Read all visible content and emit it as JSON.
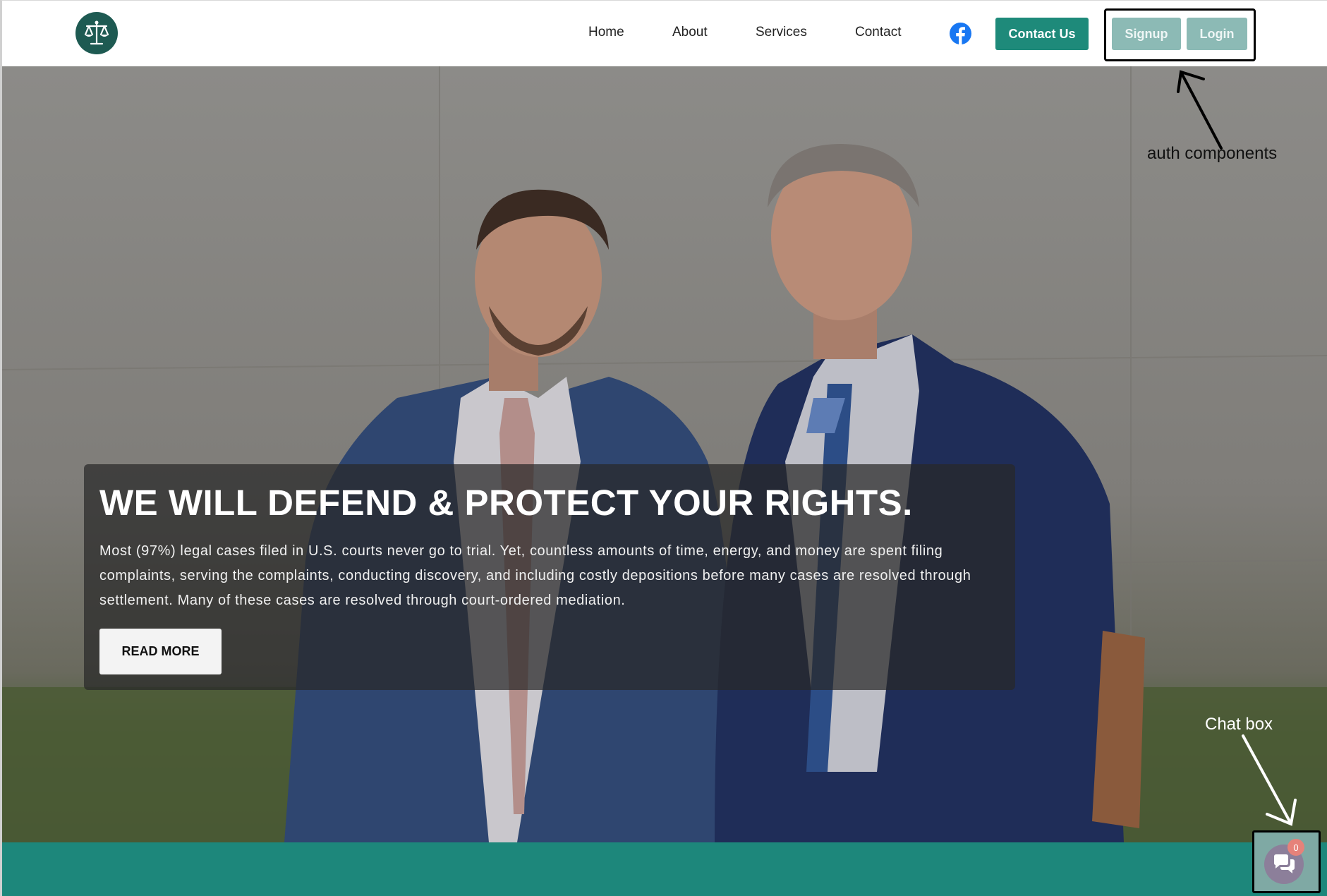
{
  "nav": {
    "items": [
      {
        "label": "Home"
      },
      {
        "label": "About"
      },
      {
        "label": "Services"
      },
      {
        "label": "Contact"
      }
    ],
    "contact_button": "Contact Us",
    "auth": {
      "signup": "Signup",
      "login": "Login"
    }
  },
  "hero": {
    "headline": "WE WILL DEFEND & PROTECT YOUR RIGHTS.",
    "paragraph": "Most (97%) legal cases filed in U.S. courts never go to trial. Yet, countless amounts of time, energy, and money are spent filing complaints, serving the complaints, conducting discovery, and including costly depositions before many cases are resolved through settlement. Many of these cases are resolved through court-ordered mediation.",
    "read_more": "READ MORE"
  },
  "annotations": {
    "auth": "auth components",
    "chat": "Chat box"
  },
  "chat": {
    "badge_count": "0"
  },
  "icons": {
    "logo": "scales-of-justice-icon",
    "social": "facebook-icon",
    "chat": "chat-bubbles-icon"
  },
  "colors": {
    "brand_teal": "#1e8a7a",
    "logo_bg": "#1e5a52",
    "facebook": "#1877f2",
    "auth_disabled": "#8cbab5",
    "badge": "#e6827a"
  }
}
